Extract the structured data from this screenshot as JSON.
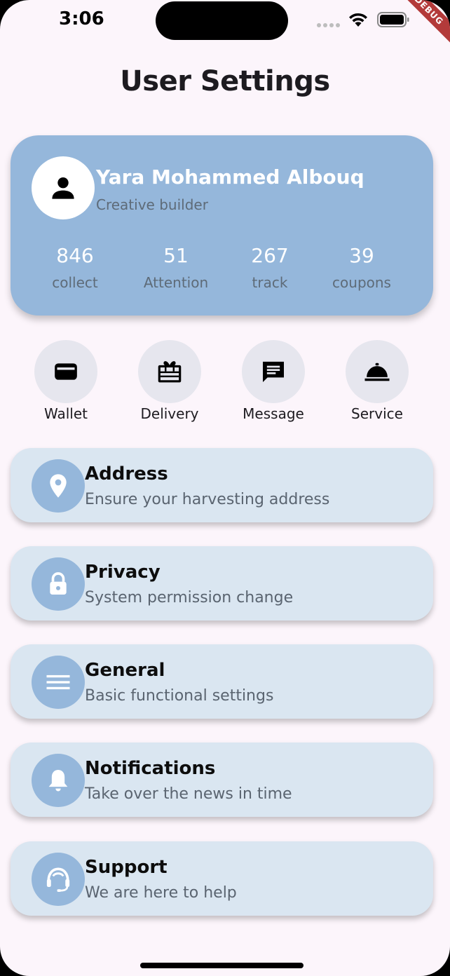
{
  "status_bar": {
    "time": "3:06",
    "debug_label": "DEBUG"
  },
  "page": {
    "title": "User Settings"
  },
  "profile": {
    "name": "Yara Mohammed Albouq",
    "role": "Creative builder",
    "avatar_icon": "person-icon",
    "stats": [
      {
        "value": "846",
        "label": "collect"
      },
      {
        "value": "51",
        "label": "Attention"
      },
      {
        "value": "267",
        "label": "track"
      },
      {
        "value": "39",
        "label": "coupons"
      }
    ]
  },
  "quick_actions": [
    {
      "label": "Wallet",
      "icon": "wallet-icon"
    },
    {
      "label": "Delivery",
      "icon": "gift-box-icon"
    },
    {
      "label": "Message",
      "icon": "message-icon"
    },
    {
      "label": "Service",
      "icon": "room-service-icon"
    }
  ],
  "settings": [
    {
      "title": "Address",
      "subtitle": "Ensure your harvesting address",
      "icon": "location-pin-icon"
    },
    {
      "title": "Privacy",
      "subtitle": "System permission change",
      "icon": "lock-icon"
    },
    {
      "title": "General",
      "subtitle": "Basic functional settings",
      "icon": "menu-icon"
    },
    {
      "title": "Notifications",
      "subtitle": "Take over the news in time",
      "icon": "bell-icon"
    },
    {
      "title": "Support",
      "subtitle": "We are here to help",
      "icon": "headset-icon"
    }
  ],
  "colors": {
    "background": "#fcf5fb",
    "profile_card": "#95b7db",
    "setting_card": "#dae6f1",
    "icon_circle": "#95b7db",
    "quick_action_circle": "#e6e6ee",
    "debug_banner": "#b33a3a"
  }
}
